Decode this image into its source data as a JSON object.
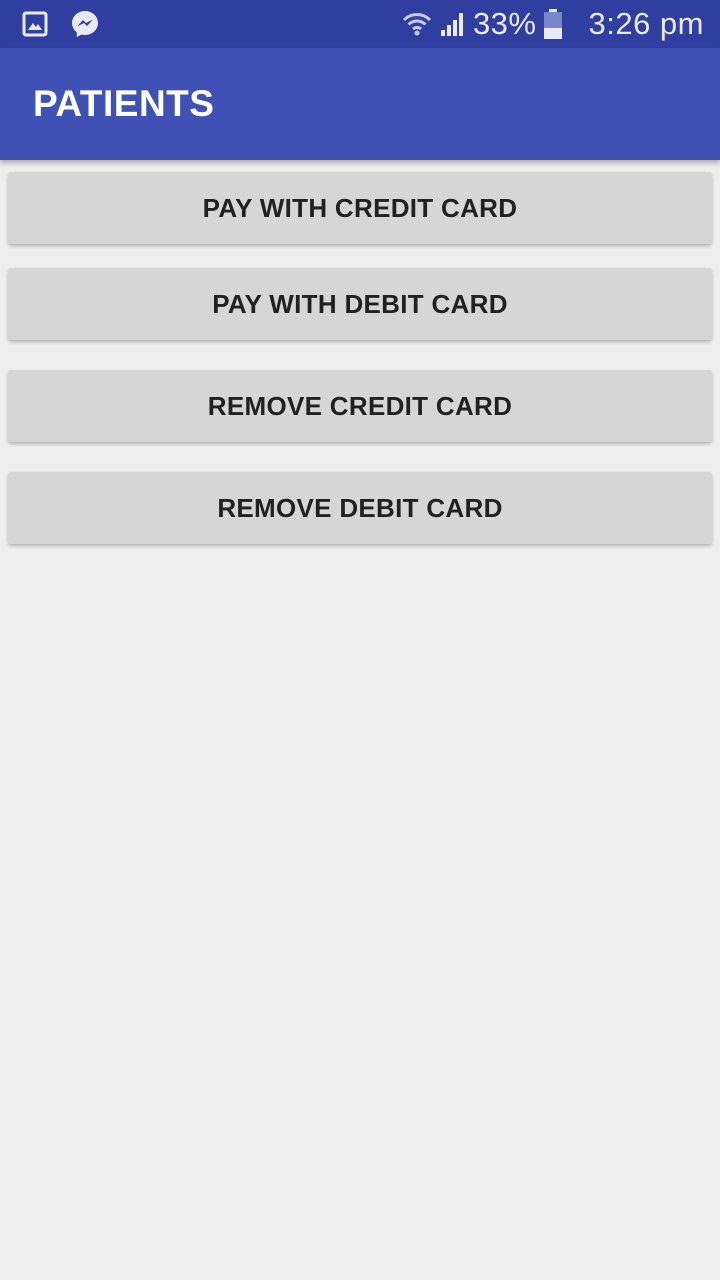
{
  "status_bar": {
    "icons_left": [
      "gallery-icon",
      "messenger-icon"
    ],
    "icons_right": [
      "wifi-icon",
      "signal-icon",
      "battery-icon"
    ],
    "battery_text": "33%",
    "time": "3:26 pm"
  },
  "app_bar": {
    "title": "PATIENTS"
  },
  "buttons": {
    "pay_credit": "PAY WITH CREDIT CARD",
    "pay_debit": "PAY WITH DEBIT CARD",
    "remove_credit": "REMOVE CREDIT CARD",
    "remove_debit": "REMOVE DEBIT CARD"
  },
  "colors": {
    "status_bar": "#303f9f",
    "app_bar": "#3f51b5",
    "background": "#eeeeee",
    "button": "#d6d6d6",
    "button_text": "#212121"
  }
}
